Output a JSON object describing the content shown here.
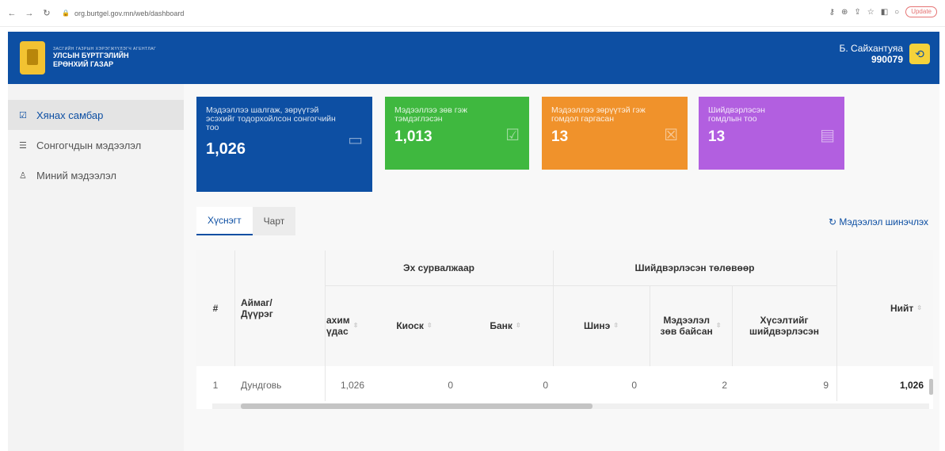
{
  "browser": {
    "url": "org.burtgel.gov.mn/web/dashboard",
    "update_label": "Update"
  },
  "header": {
    "org_small": "ЗАСГИЙН ГАЗРЫН ХЭРЭГЖҮҮЛЭГЧ АГЕНТЛАГ",
    "org_line1": "УЛСЫН БҮРТГЭЛИЙН",
    "org_line2": "ЕРӨНХИЙ ГАЗАР",
    "user_name": "Б. Сайхантуяа",
    "user_id": "990079"
  },
  "sidebar": {
    "items": [
      {
        "label": "Хянах самбар"
      },
      {
        "label": "Сонгогчдын мэдээлэл"
      },
      {
        "label": "Миний мэдээлэл"
      }
    ]
  },
  "cards": [
    {
      "title": "Мэдээллээ шалгаж, зөрүүтэй эсэхийг тодорхойлсон сонгогчийн тоо",
      "value": "1,026",
      "color": "#0d4fa3"
    },
    {
      "title": "Мэдээллээ зөв гэж тэмдэглэсэн",
      "value": "1,013",
      "color": "#3fb83f"
    },
    {
      "title": "Мэдээллээ зөрүүтэй гэж гомдол гаргасан",
      "value": "13",
      "color": "#f0922b"
    },
    {
      "title": "Шийдвэрлэсэн гомдлын тоо",
      "value": "13",
      "color": "#b25fe0"
    }
  ],
  "tabs": [
    {
      "label": "Хүснэгт"
    },
    {
      "label": "Чарт"
    }
  ],
  "refresh_label": "Мэдээлэл шинэчлэх",
  "table": {
    "group_source": "Эх сурвалжаар",
    "group_resolved": "Шийдвэрлэсэн төлөвөөр",
    "col_num": "#",
    "col_aimag_1": "Аймаг/",
    "col_aimag_2": "Дүүрэг",
    "col_digital_1": "ахим",
    "col_digital_2": "үдас",
    "col_kiosk": "Киоск",
    "col_bank": "Банк",
    "col_new": "Шинэ",
    "col_correct_1": "Мэдээлэл",
    "col_correct_2": "зөв байсан",
    "col_resolved_1": "Хүсэлтийг",
    "col_resolved_2": "шийдвэрлэсэн",
    "col_total": "Нийт",
    "rows": [
      {
        "num": "1",
        "aimag": "Дундговь",
        "digital": "1,026",
        "kiosk": "0",
        "bank": "0",
        "new": "0",
        "correct": "2",
        "resolved": "9",
        "total": "1,026"
      }
    ]
  }
}
